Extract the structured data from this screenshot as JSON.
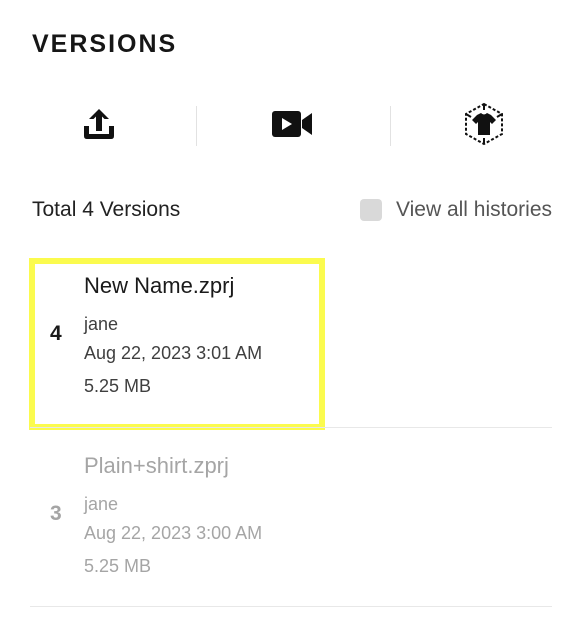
{
  "panel": {
    "title": "VERSIONS"
  },
  "toolbar": {
    "buttons": [
      {
        "icon": "upload-icon"
      },
      {
        "icon": "video-icon"
      },
      {
        "icon": "3d-garment-icon"
      }
    ]
  },
  "summary": {
    "total_label": "Total 4 Versions",
    "view_all_label": "View all histories",
    "view_all_checked": false
  },
  "versions": [
    {
      "number": "4",
      "filename": "New Name.zprj",
      "user": "jane",
      "date": "Aug 22, 2023 3:01 AM",
      "size": "5.25 MB",
      "state": "selected"
    },
    {
      "number": "3",
      "filename": "Plain+shirt.zprj",
      "user": "jane",
      "date": "Aug 22, 2023 3:00 AM",
      "size": "5.25 MB",
      "state": "inactive"
    }
  ],
  "colors": {
    "highlight": "#fbfb4e",
    "muted_text": "#a5a5a5",
    "checkbox": "#d9d9d9"
  }
}
